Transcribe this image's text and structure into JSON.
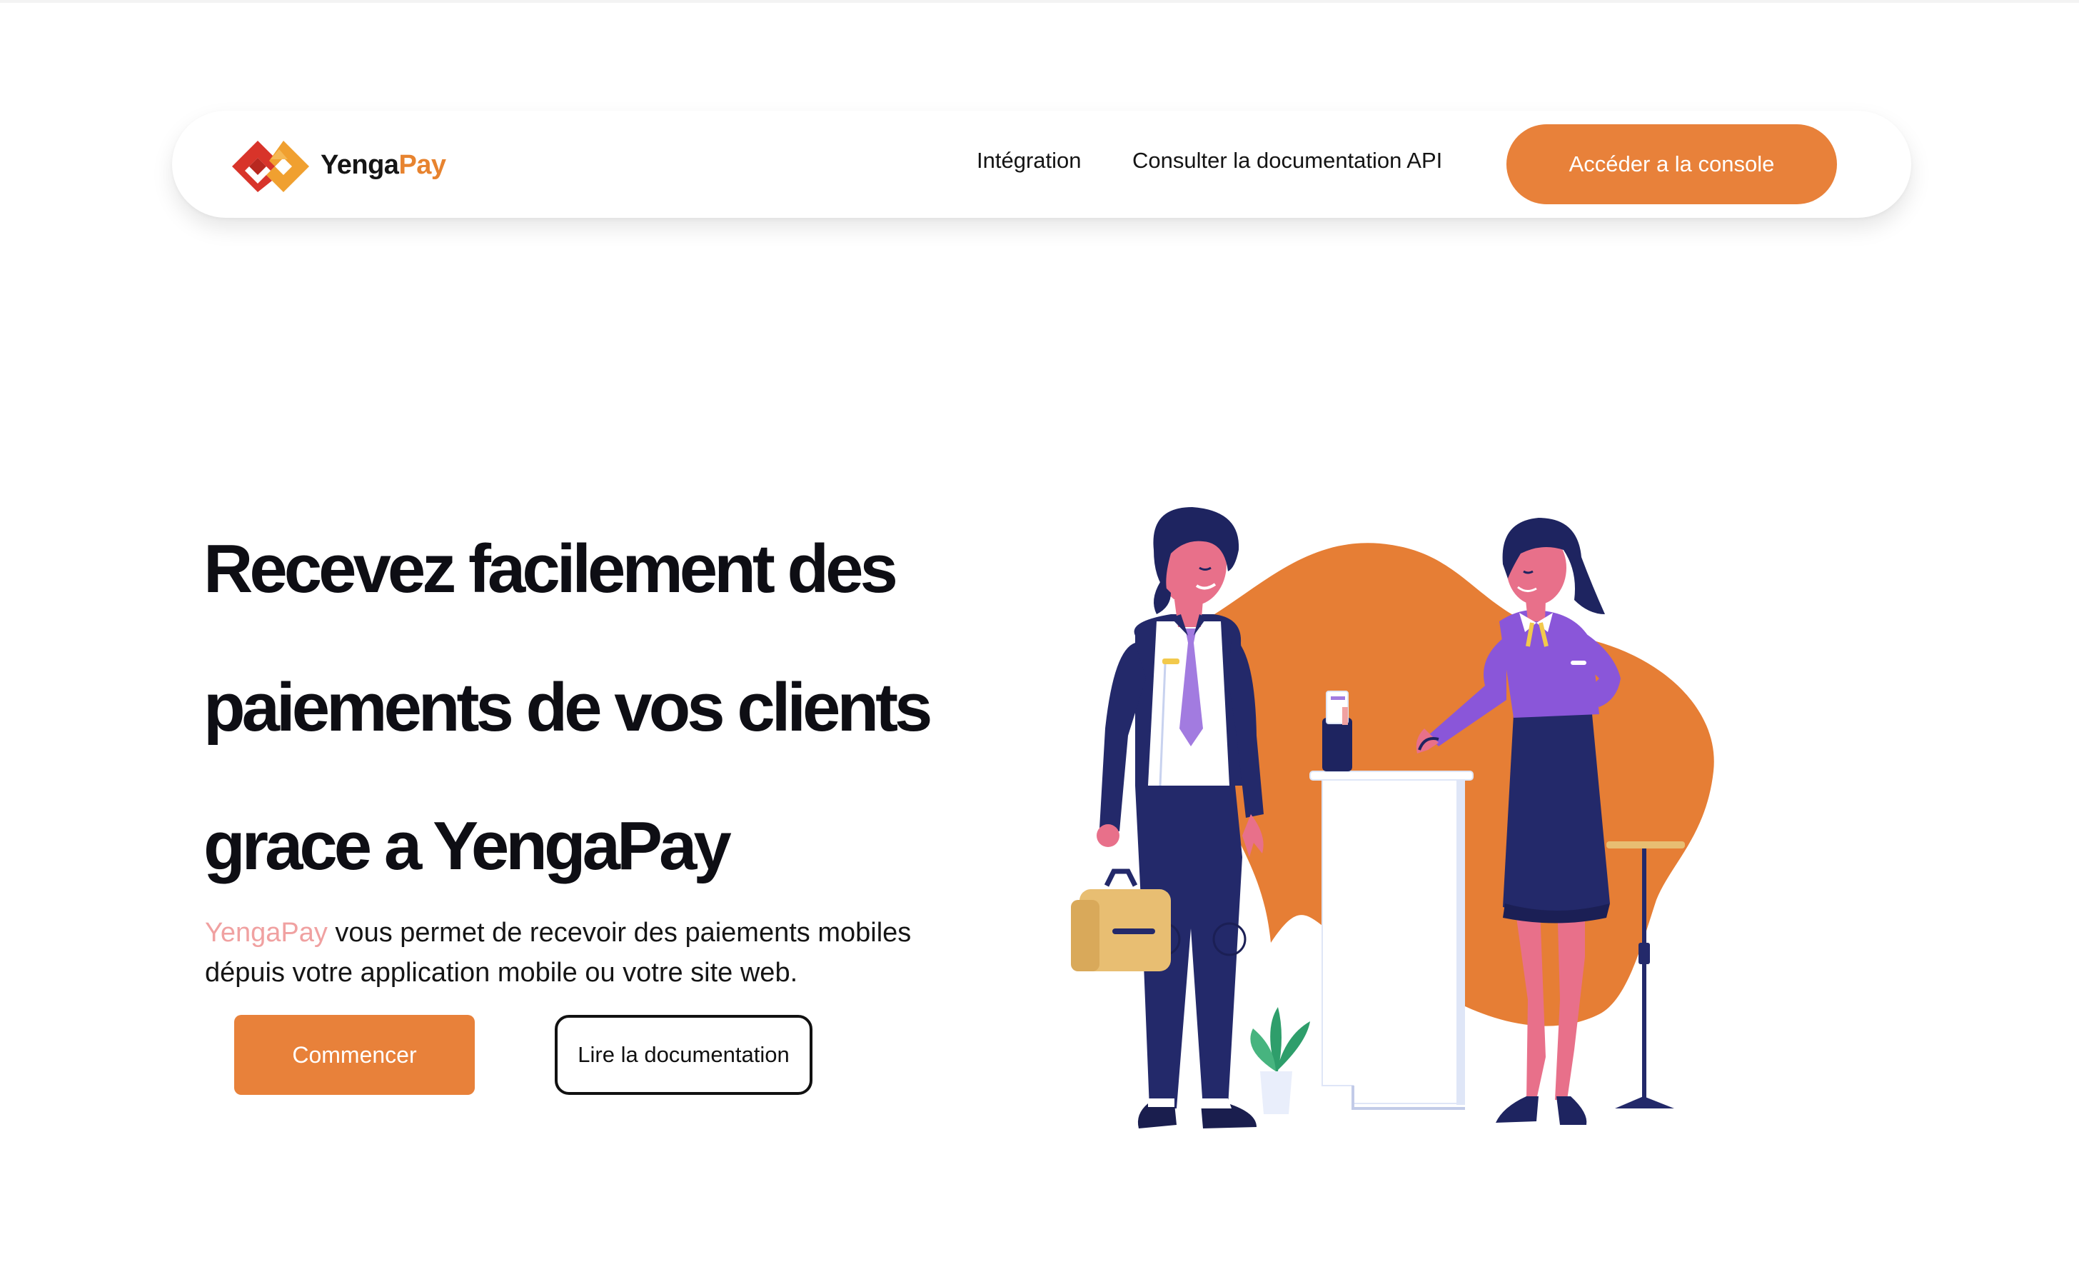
{
  "brand": {
    "name_part1": "Yenga",
    "name_part2": "Pay",
    "primary_color": "#E8813A",
    "logo_colors": [
      "#D8342A",
      "#F0A030"
    ]
  },
  "nav": {
    "links": [
      {
        "label": "Intégration"
      },
      {
        "label": "Consulter la documentation API"
      }
    ],
    "cta_label": "Accéder a la console"
  },
  "hero": {
    "title_lines": [
      "Recevez facilement des",
      "paiements de vos clients",
      "grace a YengaPay"
    ],
    "desc_brand": "YengaPay",
    "desc_line1_rest": " vous permet de recevoir des paiements mobiles",
    "desc_line2": "dépuis votre application mobile ou votre site web.",
    "primary_button": "Commencer",
    "secondary_button": "Lire la documentation",
    "brand_word_color": "#F0A1A1"
  },
  "illustration": {
    "icon": "payment-terminal-people-illustration"
  }
}
